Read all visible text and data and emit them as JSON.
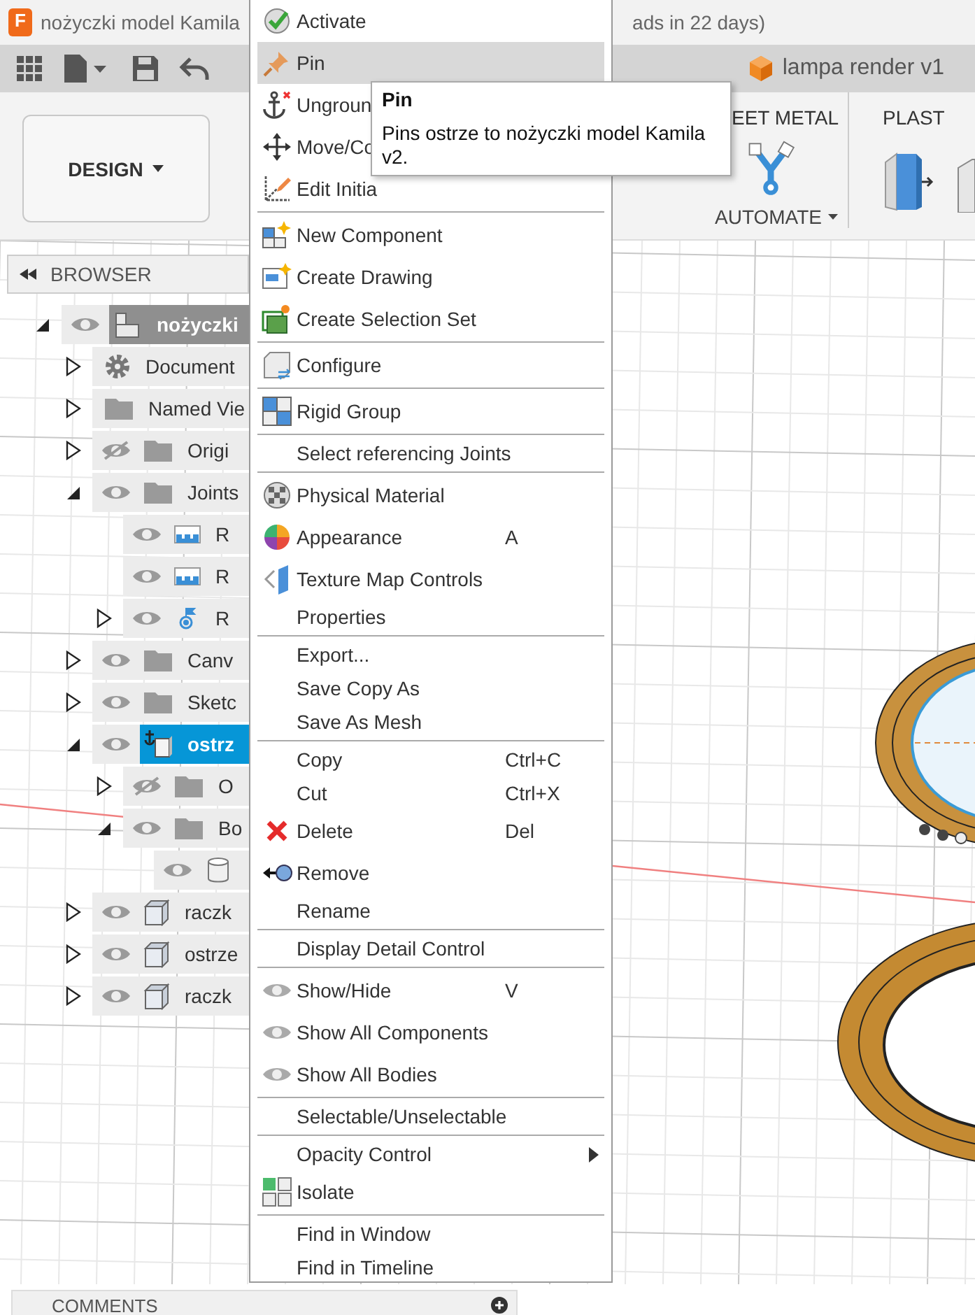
{
  "window": {
    "app_letter": "F",
    "title_left": "nożyczki model Kamila",
    "title_right": "ads in 22 days)"
  },
  "toolbar": {
    "document_tab": "lampa render v1"
  },
  "ribbon": {
    "workspace_button": "DESIGN",
    "tab_labels": [
      "EET METAL",
      "PLAST"
    ],
    "automate_label": "AUTOMATE"
  },
  "browser": {
    "title": "BROWSER",
    "tree": [
      {
        "kind": "component",
        "label": "nożyczki",
        "visible": true,
        "expanded": true,
        "selected": false,
        "active": true,
        "children": [
          {
            "kind": "gear",
            "label": "Document",
            "expanded": false,
            "selected": false
          },
          {
            "kind": "folder",
            "label": "Named Vie",
            "expanded": false,
            "selected": false
          },
          {
            "kind": "folder",
            "label": "Origi",
            "visible": false,
            "expanded": false,
            "selected": false
          },
          {
            "kind": "folder",
            "label": "Joints",
            "visible": true,
            "expanded": true,
            "selected": false,
            "children": [
              {
                "kind": "joint",
                "label": "R",
                "visible": true,
                "selected": false
              },
              {
                "kind": "joint",
                "label": "R",
                "visible": true,
                "selected": false
              },
              {
                "kind": "joint-origin",
                "label": "R",
                "visible": true,
                "expanded": false,
                "selected": false
              }
            ]
          },
          {
            "kind": "folder",
            "label": "Canv",
            "visible": true,
            "expanded": false,
            "selected": false
          },
          {
            "kind": "folder",
            "label": "Sketc",
            "visible": true,
            "expanded": false,
            "selected": false
          },
          {
            "kind": "grounded-component",
            "label": "ostrz",
            "visible": true,
            "expanded": true,
            "selected": true,
            "children": [
              {
                "kind": "folder",
                "label": "O",
                "visible": false,
                "expanded": false,
                "selected": false
              },
              {
                "kind": "folder",
                "label": "Bo",
                "visible": true,
                "expanded": true,
                "selected": false,
                "children": [
                  {
                    "kind": "body",
                    "visible": true,
                    "selected": false
                  }
                ]
              }
            ]
          },
          {
            "kind": "component-box",
            "label": "raczk",
            "visible": true,
            "expanded": false,
            "selected": false
          },
          {
            "kind": "component-box",
            "label": "ostrze",
            "visible": true,
            "expanded": false,
            "selected": false
          },
          {
            "kind": "component-box",
            "label": "raczk",
            "visible": true,
            "expanded": false,
            "selected": false
          }
        ]
      }
    ]
  },
  "context_menu": {
    "sections": [
      [
        {
          "kind": "check",
          "label": "Activate",
          "selected": false
        },
        {
          "kind": "pin",
          "label": "Pin",
          "selected": true
        },
        {
          "kind": "anchor",
          "label": "Ungroun",
          "selected": false
        },
        {
          "kind": "move",
          "label": "Move/Co",
          "selected": false
        },
        {
          "kind": "axes",
          "label": "Edit Initia",
          "selected": false
        }
      ],
      [
        {
          "kind": "new-component",
          "label": "New Component",
          "selected": false
        },
        {
          "kind": "drawing",
          "label": "Create Drawing",
          "selected": false
        },
        {
          "kind": "selection-set",
          "label": "Create Selection Set",
          "selected": false
        }
      ],
      [
        {
          "kind": "configure",
          "label": "Configure",
          "selected": false
        }
      ],
      [
        {
          "kind": "rigid-group",
          "label": "Rigid Group",
          "selected": false
        }
      ],
      [
        {
          "kind": "plain",
          "label": "Select referencing Joints",
          "selected": false
        }
      ],
      [
        {
          "kind": "material",
          "label": "Physical Material",
          "selected": false
        },
        {
          "kind": "appearance",
          "label": "Appearance",
          "shortcut": "A",
          "selected": false
        },
        {
          "kind": "texture",
          "label": "Texture Map Controls",
          "selected": false
        },
        {
          "kind": "plain",
          "label": "Properties",
          "selected": false
        }
      ],
      [
        {
          "kind": "plain",
          "label": "Export...",
          "selected": false
        },
        {
          "kind": "plain",
          "label": "Save Copy As",
          "selected": false
        },
        {
          "kind": "plain",
          "label": "Save As Mesh",
          "selected": false
        }
      ],
      [
        {
          "kind": "plain",
          "label": "Copy",
          "shortcut": "Ctrl+C",
          "selected": false
        },
        {
          "kind": "plain",
          "label": "Cut",
          "shortcut": "Ctrl+X",
          "selected": false
        },
        {
          "kind": "delete",
          "label": "Delete",
          "shortcut": "Del",
          "selected": false
        },
        {
          "kind": "remove",
          "label": "Remove",
          "selected": false
        },
        {
          "kind": "plain",
          "label": "Rename",
          "selected": false
        }
      ],
      [
        {
          "kind": "plain",
          "label": "Display Detail Control",
          "selected": false
        }
      ],
      [
        {
          "kind": "eye",
          "label": "Show/Hide",
          "shortcut": "V",
          "selected": false
        },
        {
          "kind": "eye",
          "label": "Show All Components",
          "selected": false
        },
        {
          "kind": "eye",
          "label": "Show All Bodies",
          "selected": false
        }
      ],
      [
        {
          "kind": "plain",
          "label": "Selectable/Unselectable",
          "selected": false
        }
      ],
      [
        {
          "kind": "plain",
          "label": "Opacity Control",
          "submenu": true,
          "selected": false
        },
        {
          "kind": "isolate",
          "label": "Isolate",
          "selected": false
        }
      ],
      [
        {
          "kind": "plain",
          "label": "Find in Window",
          "selected": false
        },
        {
          "kind": "plain",
          "label": "Find in Timeline",
          "selected": false
        }
      ]
    ]
  },
  "tooltip": {
    "title": "Pin",
    "text": "Pins ostrze to nożyczki model Kamila v2."
  },
  "comments": {
    "title": "COMMENTS"
  }
}
